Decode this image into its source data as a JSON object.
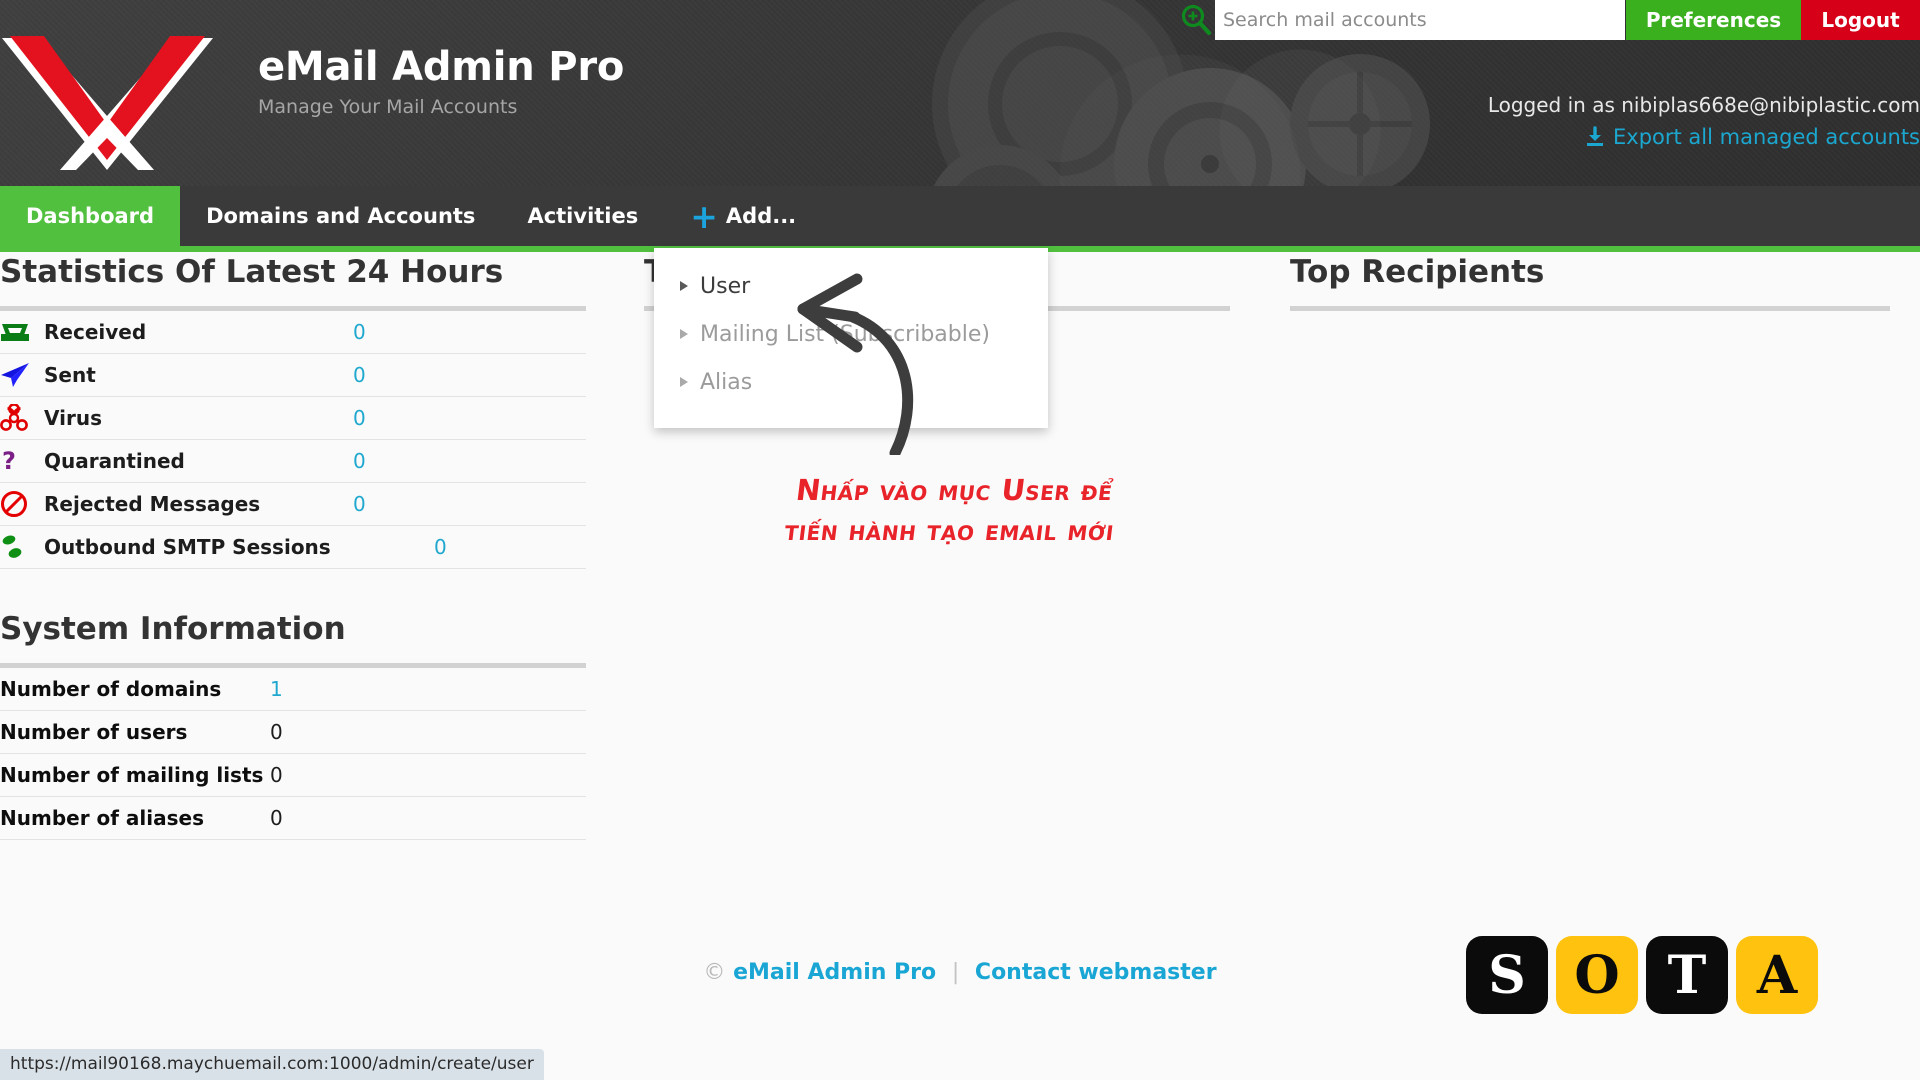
{
  "header": {
    "brand_title": "eMail Admin Pro",
    "brand_subtitle": "Manage Your Mail Accounts",
    "logo_icon": "envelope-x-logo",
    "search": {
      "icon": "search-zoom-in-icon",
      "placeholder": "Search mail accounts",
      "value": ""
    },
    "preferences_label": "Preferences",
    "logout_label": "Logout",
    "logged_in_text": "Logged in as nibiplas668e@nibiplastic.com",
    "export_label": "Export all managed accounts",
    "export_icon": "download-icon",
    "accent_green": "#3ab01e",
    "accent_red": "#d60019",
    "accent_cyan": "#1ba7cf"
  },
  "nav": {
    "items": [
      {
        "label": "Dashboard",
        "active": true
      },
      {
        "label": "Domains and Accounts",
        "active": false
      },
      {
        "label": "Activities",
        "active": false
      },
      {
        "label": "Add...",
        "active": false,
        "icon": "plus-icon"
      }
    ],
    "active_color": "#51c03f"
  },
  "dropdown": {
    "items": [
      {
        "label": "User",
        "enabled": true,
        "icon": "caret-right-icon"
      },
      {
        "label": "Mailing List (Subscribable)",
        "enabled": false,
        "icon": "caret-right-icon"
      },
      {
        "label": "Alias",
        "enabled": false,
        "icon": "caret-right-icon"
      }
    ]
  },
  "statistics": {
    "title": "Statistics Of Latest 24 Hours",
    "rows": [
      {
        "icon": "inbox-tray-icon",
        "label": "Received",
        "value": "0"
      },
      {
        "icon": "paper-plane-icon",
        "label": "Sent",
        "value": "0"
      },
      {
        "icon": "biohazard-icon",
        "label": "Virus",
        "value": "0"
      },
      {
        "icon": "question-mark-icon",
        "label": "Quarantined",
        "value": "0"
      },
      {
        "icon": "no-entry-icon",
        "label": "Rejected Messages",
        "value": "0"
      },
      {
        "icon": "footprints-icon",
        "label": "Outbound SMTP Sessions",
        "value": "0"
      }
    ]
  },
  "system_information": {
    "title": "System Information",
    "rows": [
      {
        "label": "Number of domains",
        "value": "1",
        "link": true
      },
      {
        "label": "Number of users",
        "value": "0",
        "link": false
      },
      {
        "label": "Number of mailing lists",
        "value": "0",
        "link": false
      },
      {
        "label": "Number of aliases",
        "value": "0",
        "link": false
      }
    ]
  },
  "top_senders": {
    "title": "Top Senders"
  },
  "top_recipients": {
    "title": "Top Recipients"
  },
  "annotation": {
    "line1": "Nhấp vào mục User để",
    "line2": "tiến hành tạo email mới",
    "color": "#e8242a",
    "arrow_icon": "curved-arrow-icon"
  },
  "footer": {
    "copyright_symbol": "©",
    "brand_link": "eMail Admin Pro",
    "separator": "|",
    "contact_link": "Contact webmaster"
  },
  "sota_logo": {
    "tiles": [
      {
        "letter": "S",
        "style": "dark"
      },
      {
        "letter": "O",
        "style": "gold"
      },
      {
        "letter": "T",
        "style": "dark"
      },
      {
        "letter": "A",
        "style": "gold"
      }
    ],
    "gold": "#ffc20e"
  },
  "statusbar": {
    "url": "https://mail90168.maychuemail.com:1000/admin/create/user"
  }
}
